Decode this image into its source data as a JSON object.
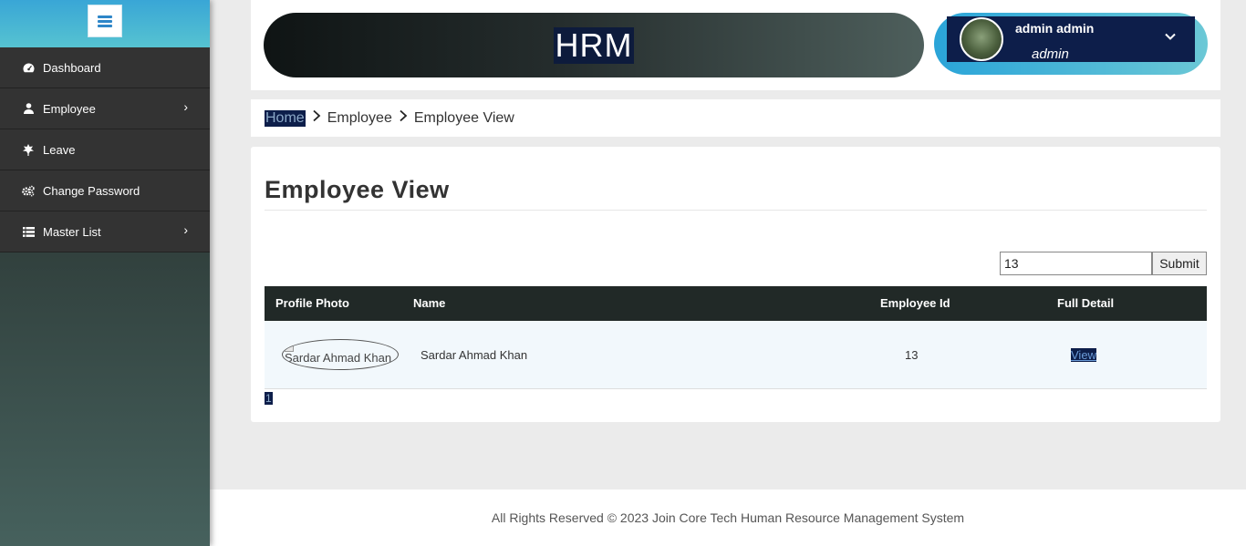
{
  "sidebar": {
    "items": [
      {
        "label": "Dashboard",
        "icon": "tachometer-icon"
      },
      {
        "label": "Employee",
        "icon": "user-icon",
        "has_submenu": true
      },
      {
        "label": "Leave",
        "icon": "leaf-icon"
      },
      {
        "label": "Change Password",
        "icon": "cogs-icon"
      },
      {
        "label": "Master List",
        "icon": "list-icon",
        "has_submenu": true
      }
    ]
  },
  "header": {
    "brand": "HRM",
    "user": {
      "name": "admin admin",
      "role": "admin"
    }
  },
  "breadcrumb": [
    "Home",
    "Employee",
    "Employee View"
  ],
  "page": {
    "title": "Employee View",
    "search": {
      "value": "13",
      "submit_label": "Submit"
    },
    "table": {
      "headers": [
        "Profile Photo",
        "Name",
        "Employee Id",
        "Full Detail"
      ],
      "rows": [
        {
          "photo_alt": "Sardar Ahmad Khan",
          "name": "Sardar Ahmad Khan",
          "employee_id": "13",
          "detail_link": "View"
        }
      ]
    },
    "pagination": "1"
  },
  "footer": "All Rights Reserved © 2023 Join Core Tech Human Resource Management System",
  "colors": {
    "accent": "#2aa4d8",
    "table_header": "#212927",
    "sidebar": "#333333"
  }
}
